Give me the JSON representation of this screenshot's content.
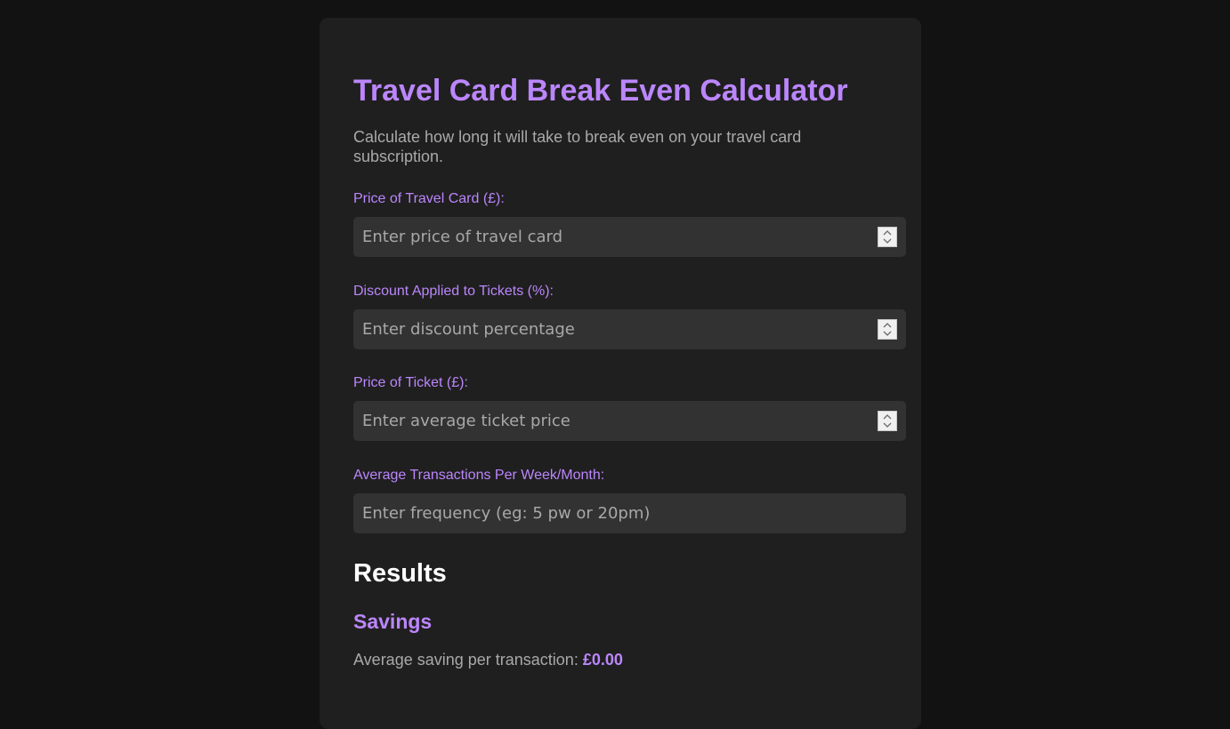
{
  "header": {
    "title": "Travel Card Break Even Calculator",
    "subtitle": "Calculate how long it will take to break even on your travel card subscription."
  },
  "form": {
    "card_price": {
      "label": "Price of Travel Card (£):",
      "placeholder": "Enter price of travel card",
      "value": ""
    },
    "discount": {
      "label": "Discount Applied to Tickets (%):",
      "placeholder": "Enter discount percentage",
      "value": ""
    },
    "ticket_price": {
      "label": "Price of Ticket (£):",
      "placeholder": "Enter average ticket price",
      "value": ""
    },
    "frequency": {
      "label": "Average Transactions Per Week/Month:",
      "placeholder": "Enter frequency (eg: 5 pw or 20pm)",
      "value": ""
    }
  },
  "results": {
    "heading": "Results",
    "savings_heading": "Savings",
    "avg_saving_label": "Average saving per transaction:",
    "avg_saving_value": "£0.00"
  },
  "colors": {
    "accent": "#bb86fc",
    "background": "#121212",
    "card": "#1f1f1f",
    "input": "#323232"
  }
}
